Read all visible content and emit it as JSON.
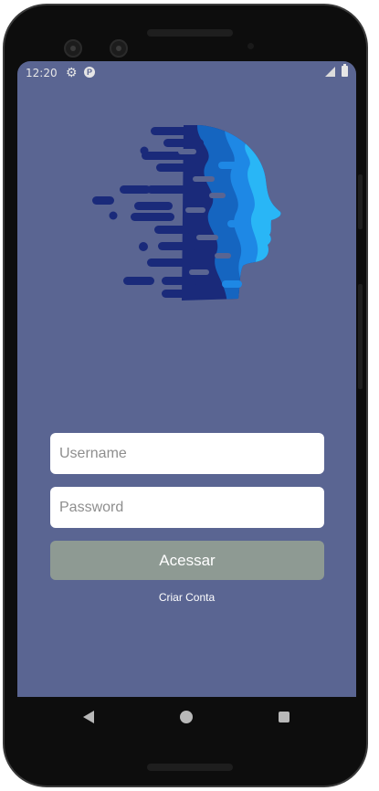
{
  "status_bar": {
    "time": "12:20",
    "icons": [
      "gear-icon",
      "p-badge-icon",
      "signal-icon",
      "battery-icon"
    ]
  },
  "logo": {
    "icon": "face-profile-logo",
    "colors": [
      "#1a2a7a",
      "#1565c0",
      "#1e88e5",
      "#29b6f6"
    ]
  },
  "login": {
    "username_placeholder": "Username",
    "username_value": "",
    "password_placeholder": "Password",
    "password_value": "",
    "access_label": "Acessar",
    "create_account_label": "Criar Conta"
  },
  "navigation": {
    "icons": [
      "back-icon",
      "home-icon",
      "recents-icon"
    ]
  },
  "theme": {
    "background": "#5a6592",
    "button": "#8e9a93"
  }
}
